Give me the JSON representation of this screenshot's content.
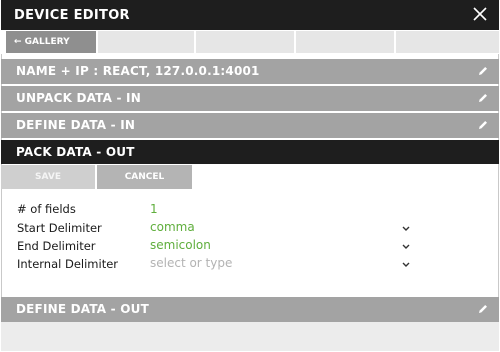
{
  "window": {
    "title": "DEVICE EDITOR"
  },
  "tabs": {
    "gallery_label": "← GALLERY"
  },
  "sections": {
    "name_ip": "NAME + IP : REACT, 127.0.0.1:4001",
    "unpack_in": "UNPACK DATA - IN",
    "define_in": "DEFINE DATA - IN",
    "pack_out": "PACK DATA - OUT",
    "define_out": "DEFINE DATA - OUT"
  },
  "actions": {
    "save_label": "SAVE",
    "cancel_label": "CANCEL"
  },
  "form": {
    "fields": [
      {
        "label": "# of fields",
        "value": "1"
      },
      {
        "label": "Start Delimiter",
        "value": "comma"
      },
      {
        "label": "End Delimiter",
        "value": "semicolon"
      },
      {
        "label": "Internal Delimiter",
        "placeholder": "select or type"
      }
    ]
  },
  "icons": {
    "close": "close-icon",
    "edit": "pencil-icon",
    "dropdown": "chevron-down-icon"
  },
  "colors": {
    "dark_bar": "#1e1e1e",
    "section_bar": "#a3a3a3",
    "value_green": "#5fae3c",
    "placeholder_gray": "#b3b3b3"
  }
}
